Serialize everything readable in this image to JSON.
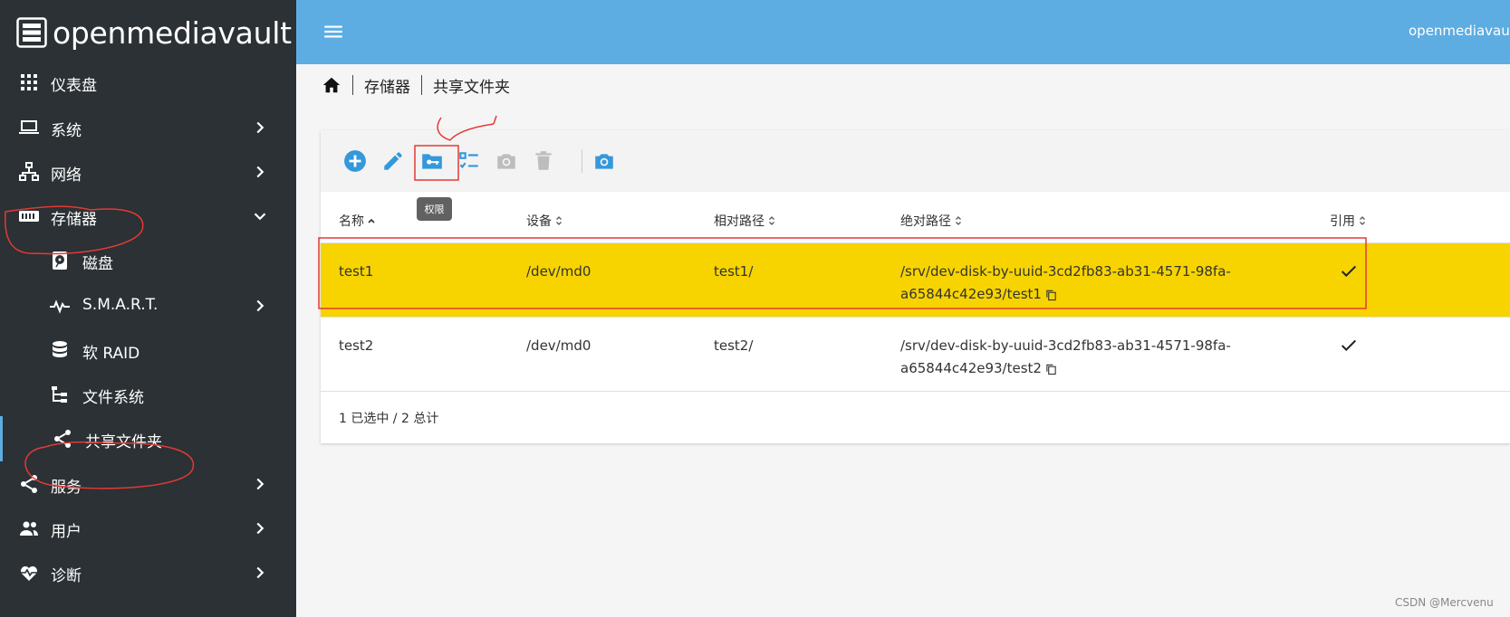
{
  "app": {
    "logo_text": "openmediavault",
    "hostname": "openmediavault"
  },
  "sidebar": {
    "items": [
      {
        "label": "仪表盘",
        "icon": "dashboard-icon"
      },
      {
        "label": "系统",
        "icon": "laptop-icon"
      },
      {
        "label": "网络",
        "icon": "network-icon"
      },
      {
        "label": "存储器",
        "icon": "storage-icon"
      },
      {
        "label": "磁盘",
        "icon": "harddisk-icon"
      },
      {
        "label": "S.M.A.R.T.",
        "icon": "pulse-icon"
      },
      {
        "label": "软 RAID",
        "icon": "database-icon"
      },
      {
        "label": "文件系统",
        "icon": "file-tree-icon"
      },
      {
        "label": "共享文件夹",
        "icon": "share-icon"
      },
      {
        "label": "服务",
        "icon": "share-icon"
      },
      {
        "label": "用户",
        "icon": "users-icon"
      },
      {
        "label": "诊断",
        "icon": "heart-pulse-icon"
      }
    ]
  },
  "breadcrumb": {
    "items": [
      "存储器",
      "共享文件夹"
    ]
  },
  "toolbar": {
    "tooltip": "权限"
  },
  "table": {
    "columns": [
      "名称",
      "设备",
      "相对路径",
      "绝对路径",
      "引用"
    ],
    "rows": [
      {
        "name": "test1",
        "device": "/dev/md0",
        "relpath": "test1/",
        "abspath_line1": "/srv/dev-disk-by-uuid-3cd2fb83-ab31-4571-98fa-",
        "abspath_line2": "a65844c42e93/test1",
        "referenced": true,
        "selected": true
      },
      {
        "name": "test2",
        "device": "/dev/md0",
        "relpath": "test2/",
        "abspath_line1": "/srv/dev-disk-by-uuid-3cd2fb83-ab31-4571-98fa-",
        "abspath_line2": "a65844c42e93/test2",
        "referenced": true,
        "selected": false
      }
    ],
    "footer": "1 已选中 / 2 总计"
  },
  "colors": {
    "sidebar_bg": "#2b3135",
    "header_bg": "#5dade2",
    "accent": "#3498db",
    "selected_row": "#f7d400",
    "annotation": "#e53935"
  },
  "watermark": "CSDN @Mercvenu"
}
